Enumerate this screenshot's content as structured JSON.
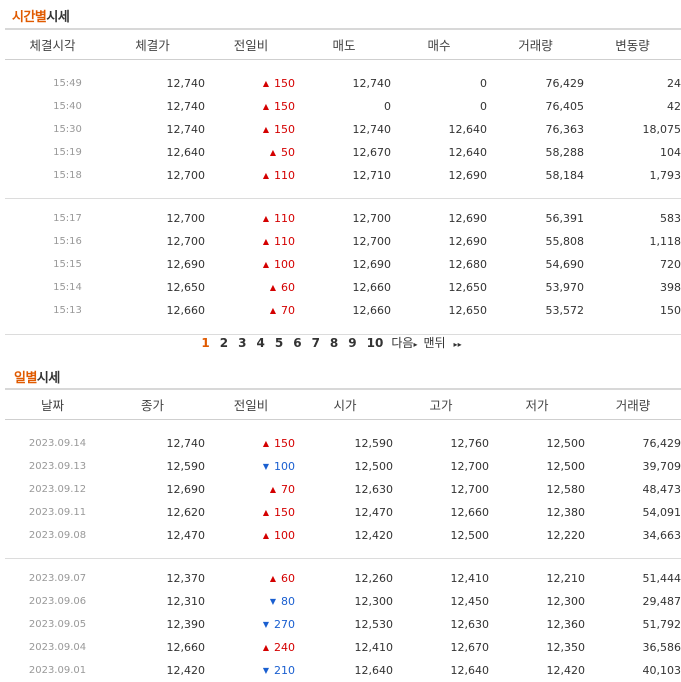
{
  "time_section": {
    "title_highlight": "시간별",
    "title_rest": "시세",
    "headers": [
      "체결시각",
      "체결가",
      "전일비",
      "매도",
      "매수",
      "거래량",
      "변동량"
    ],
    "groups": [
      [
        {
          "time": "15:49",
          "price": "12,740",
          "dir": "up",
          "change": "150",
          "sell": "12,740",
          "buy": "0",
          "volume": "76,429",
          "delta": "24"
        },
        {
          "time": "15:40",
          "price": "12,740",
          "dir": "up",
          "change": "150",
          "sell": "0",
          "buy": "0",
          "volume": "76,405",
          "delta": "42"
        },
        {
          "time": "15:30",
          "price": "12,740",
          "dir": "up",
          "change": "150",
          "sell": "12,740",
          "buy": "12,640",
          "volume": "76,363",
          "delta": "18,075"
        },
        {
          "time": "15:19",
          "price": "12,640",
          "dir": "up",
          "change": "50",
          "sell": "12,670",
          "buy": "12,640",
          "volume": "58,288",
          "delta": "104"
        },
        {
          "time": "15:18",
          "price": "12,700",
          "dir": "up",
          "change": "110",
          "sell": "12,710",
          "buy": "12,690",
          "volume": "58,184",
          "delta": "1,793"
        }
      ],
      [
        {
          "time": "15:17",
          "price": "12,700",
          "dir": "up",
          "change": "110",
          "sell": "12,700",
          "buy": "12,690",
          "volume": "56,391",
          "delta": "583"
        },
        {
          "time": "15:16",
          "price": "12,700",
          "dir": "up",
          "change": "110",
          "sell": "12,700",
          "buy": "12,690",
          "volume": "55,808",
          "delta": "1,118"
        },
        {
          "time": "15:15",
          "price": "12,690",
          "dir": "up",
          "change": "100",
          "sell": "12,690",
          "buy": "12,680",
          "volume": "54,690",
          "delta": "720"
        },
        {
          "time": "15:14",
          "price": "12,650",
          "dir": "up",
          "change": "60",
          "sell": "12,660",
          "buy": "12,650",
          "volume": "53,970",
          "delta": "398"
        },
        {
          "time": "15:13",
          "price": "12,660",
          "dir": "up",
          "change": "70",
          "sell": "12,660",
          "buy": "12,650",
          "volume": "53,572",
          "delta": "150"
        }
      ]
    ]
  },
  "pagination": {
    "current": "1",
    "pages": [
      "1",
      "2",
      "3",
      "4",
      "5",
      "6",
      "7",
      "8",
      "9",
      "10"
    ],
    "next_label": "다음",
    "last_label": "맨뒤",
    "arrow_glyph": "▸",
    "last_arrow_glyph": "▸▸"
  },
  "daily_section": {
    "title_highlight": "일별",
    "title_rest": "시세",
    "headers": [
      "날짜",
      "종가",
      "전일비",
      "시가",
      "고가",
      "저가",
      "거래량"
    ],
    "groups": [
      [
        {
          "date": "2023.09.14",
          "close": "12,740",
          "dir": "up",
          "change": "150",
          "open": "12,590",
          "high": "12,760",
          "low": "12,500",
          "volume": "76,429"
        },
        {
          "date": "2023.09.13",
          "close": "12,590",
          "dir": "down",
          "change": "100",
          "open": "12,500",
          "high": "12,700",
          "low": "12,500",
          "volume": "39,709"
        },
        {
          "date": "2023.09.12",
          "close": "12,690",
          "dir": "up",
          "change": "70",
          "open": "12,630",
          "high": "12,700",
          "low": "12,580",
          "volume": "48,473"
        },
        {
          "date": "2023.09.11",
          "close": "12,620",
          "dir": "up",
          "change": "150",
          "open": "12,470",
          "high": "12,660",
          "low": "12,380",
          "volume": "54,091"
        },
        {
          "date": "2023.09.08",
          "close": "12,470",
          "dir": "up",
          "change": "100",
          "open": "12,420",
          "high": "12,500",
          "low": "12,220",
          "volume": "34,663"
        }
      ],
      [
        {
          "date": "2023.09.07",
          "close": "12,370",
          "dir": "up",
          "change": "60",
          "open": "12,260",
          "high": "12,410",
          "low": "12,210",
          "volume": "51,444"
        },
        {
          "date": "2023.09.06",
          "close": "12,310",
          "dir": "down",
          "change": "80",
          "open": "12,300",
          "high": "12,450",
          "low": "12,300",
          "volume": "29,487"
        },
        {
          "date": "2023.09.05",
          "close": "12,390",
          "dir": "down",
          "change": "270",
          "open": "12,530",
          "high": "12,630",
          "low": "12,360",
          "volume": "51,792"
        },
        {
          "date": "2023.09.04",
          "close": "12,660",
          "dir": "up",
          "change": "240",
          "open": "12,410",
          "high": "12,670",
          "low": "12,350",
          "volume": "36,586"
        },
        {
          "date": "2023.09.01",
          "close": "12,420",
          "dir": "down",
          "change": "210",
          "open": "12,640",
          "high": "12,640",
          "low": "12,420",
          "volume": "40,103"
        }
      ]
    ]
  },
  "colors": {
    "accent": "#e05a00",
    "up": "#d40000",
    "down": "#1a5fd0"
  },
  "icons": {
    "up": "up-triangle-icon",
    "down": "down-triangle-icon"
  },
  "glyphs": {
    "up": "▲",
    "down": "▼"
  }
}
